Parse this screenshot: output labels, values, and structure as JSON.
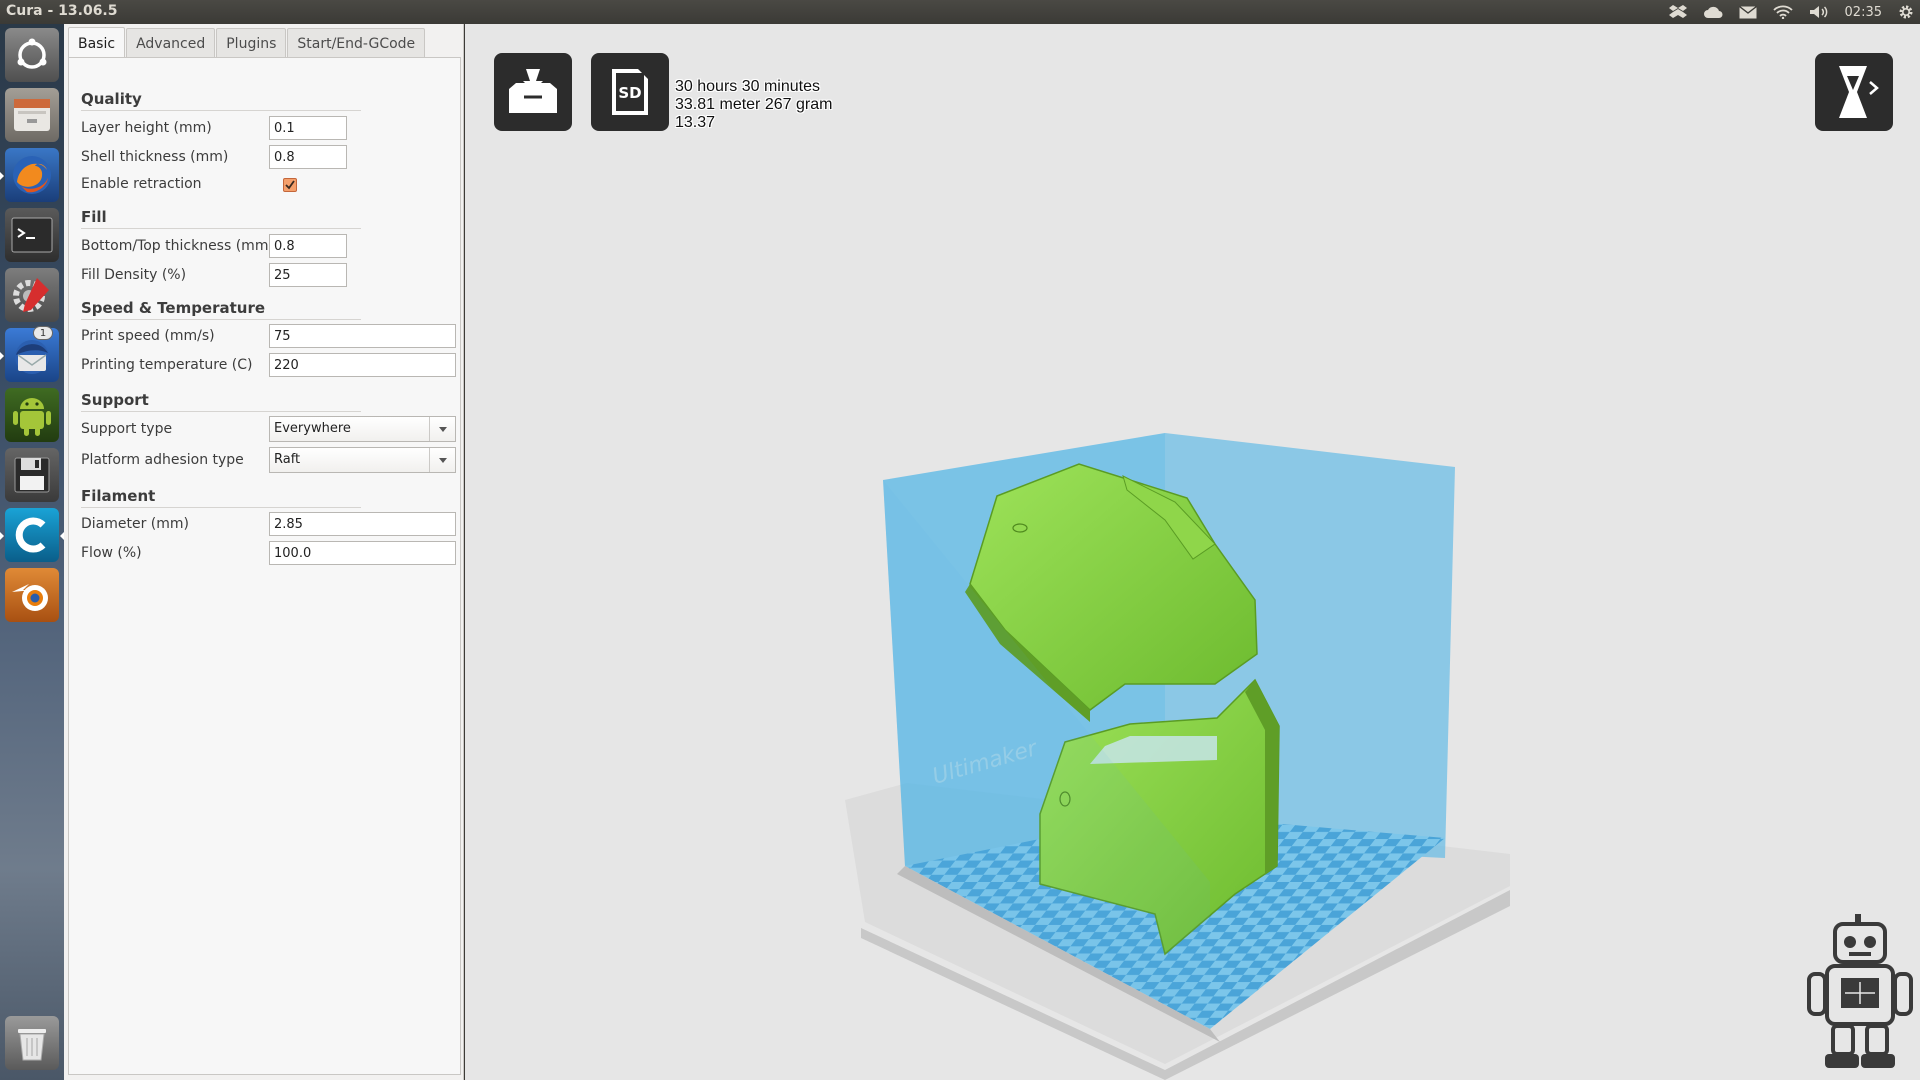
{
  "window": {
    "title": "Cura - 13.06.5"
  },
  "tray": {
    "clock": "02:35"
  },
  "launcher": {
    "email_badge": "1"
  },
  "tabs": [
    {
      "label": "Basic",
      "active": true
    },
    {
      "label": "Advanced",
      "active": false
    },
    {
      "label": "Plugins",
      "active": false
    },
    {
      "label": "Start/End-GCode",
      "active": false
    }
  ],
  "quality": {
    "title": "Quality",
    "layer_height_label": "Layer height (mm)",
    "layer_height_value": "0.1",
    "shell_thickness_label": "Shell thickness (mm)",
    "shell_thickness_value": "0.8",
    "enable_retraction_label": "Enable retraction",
    "enable_retraction_checked": true
  },
  "fill": {
    "title": "Fill",
    "bottom_top_label": "Bottom/Top thickness (mm)",
    "bottom_top_value": "0.8",
    "density_label": "Fill Density (%)",
    "density_value": "25"
  },
  "speed": {
    "title": "Speed & Temperature",
    "print_speed_label": "Print speed (mm/s)",
    "print_speed_value": "75",
    "temp_label": "Printing temperature (C)",
    "temp_value": "220"
  },
  "support": {
    "title": "Support",
    "support_type_label": "Support type",
    "support_type_value": "Everywhere",
    "adhesion_label": "Platform adhesion type",
    "adhesion_value": "Raft"
  },
  "filament": {
    "title": "Filament",
    "diameter_label": "Diameter (mm)",
    "diameter_value": "2.85",
    "flow_label": "Flow (%)",
    "flow_value": "100.0"
  },
  "print_info": {
    "time": "30 hours 30 minutes",
    "material": "33.81 meter 267 gram",
    "cost": "13.37"
  },
  "viewport": {
    "sd_label": "SD",
    "bed_brand": "Ultimaker"
  },
  "colors": {
    "model": "#8ed84a",
    "build_volume": "#5bb8e6",
    "checker_a": "#4aa4d8",
    "checker_b": "#7cc6ea",
    "panel_bg": "#f7f7f7"
  }
}
